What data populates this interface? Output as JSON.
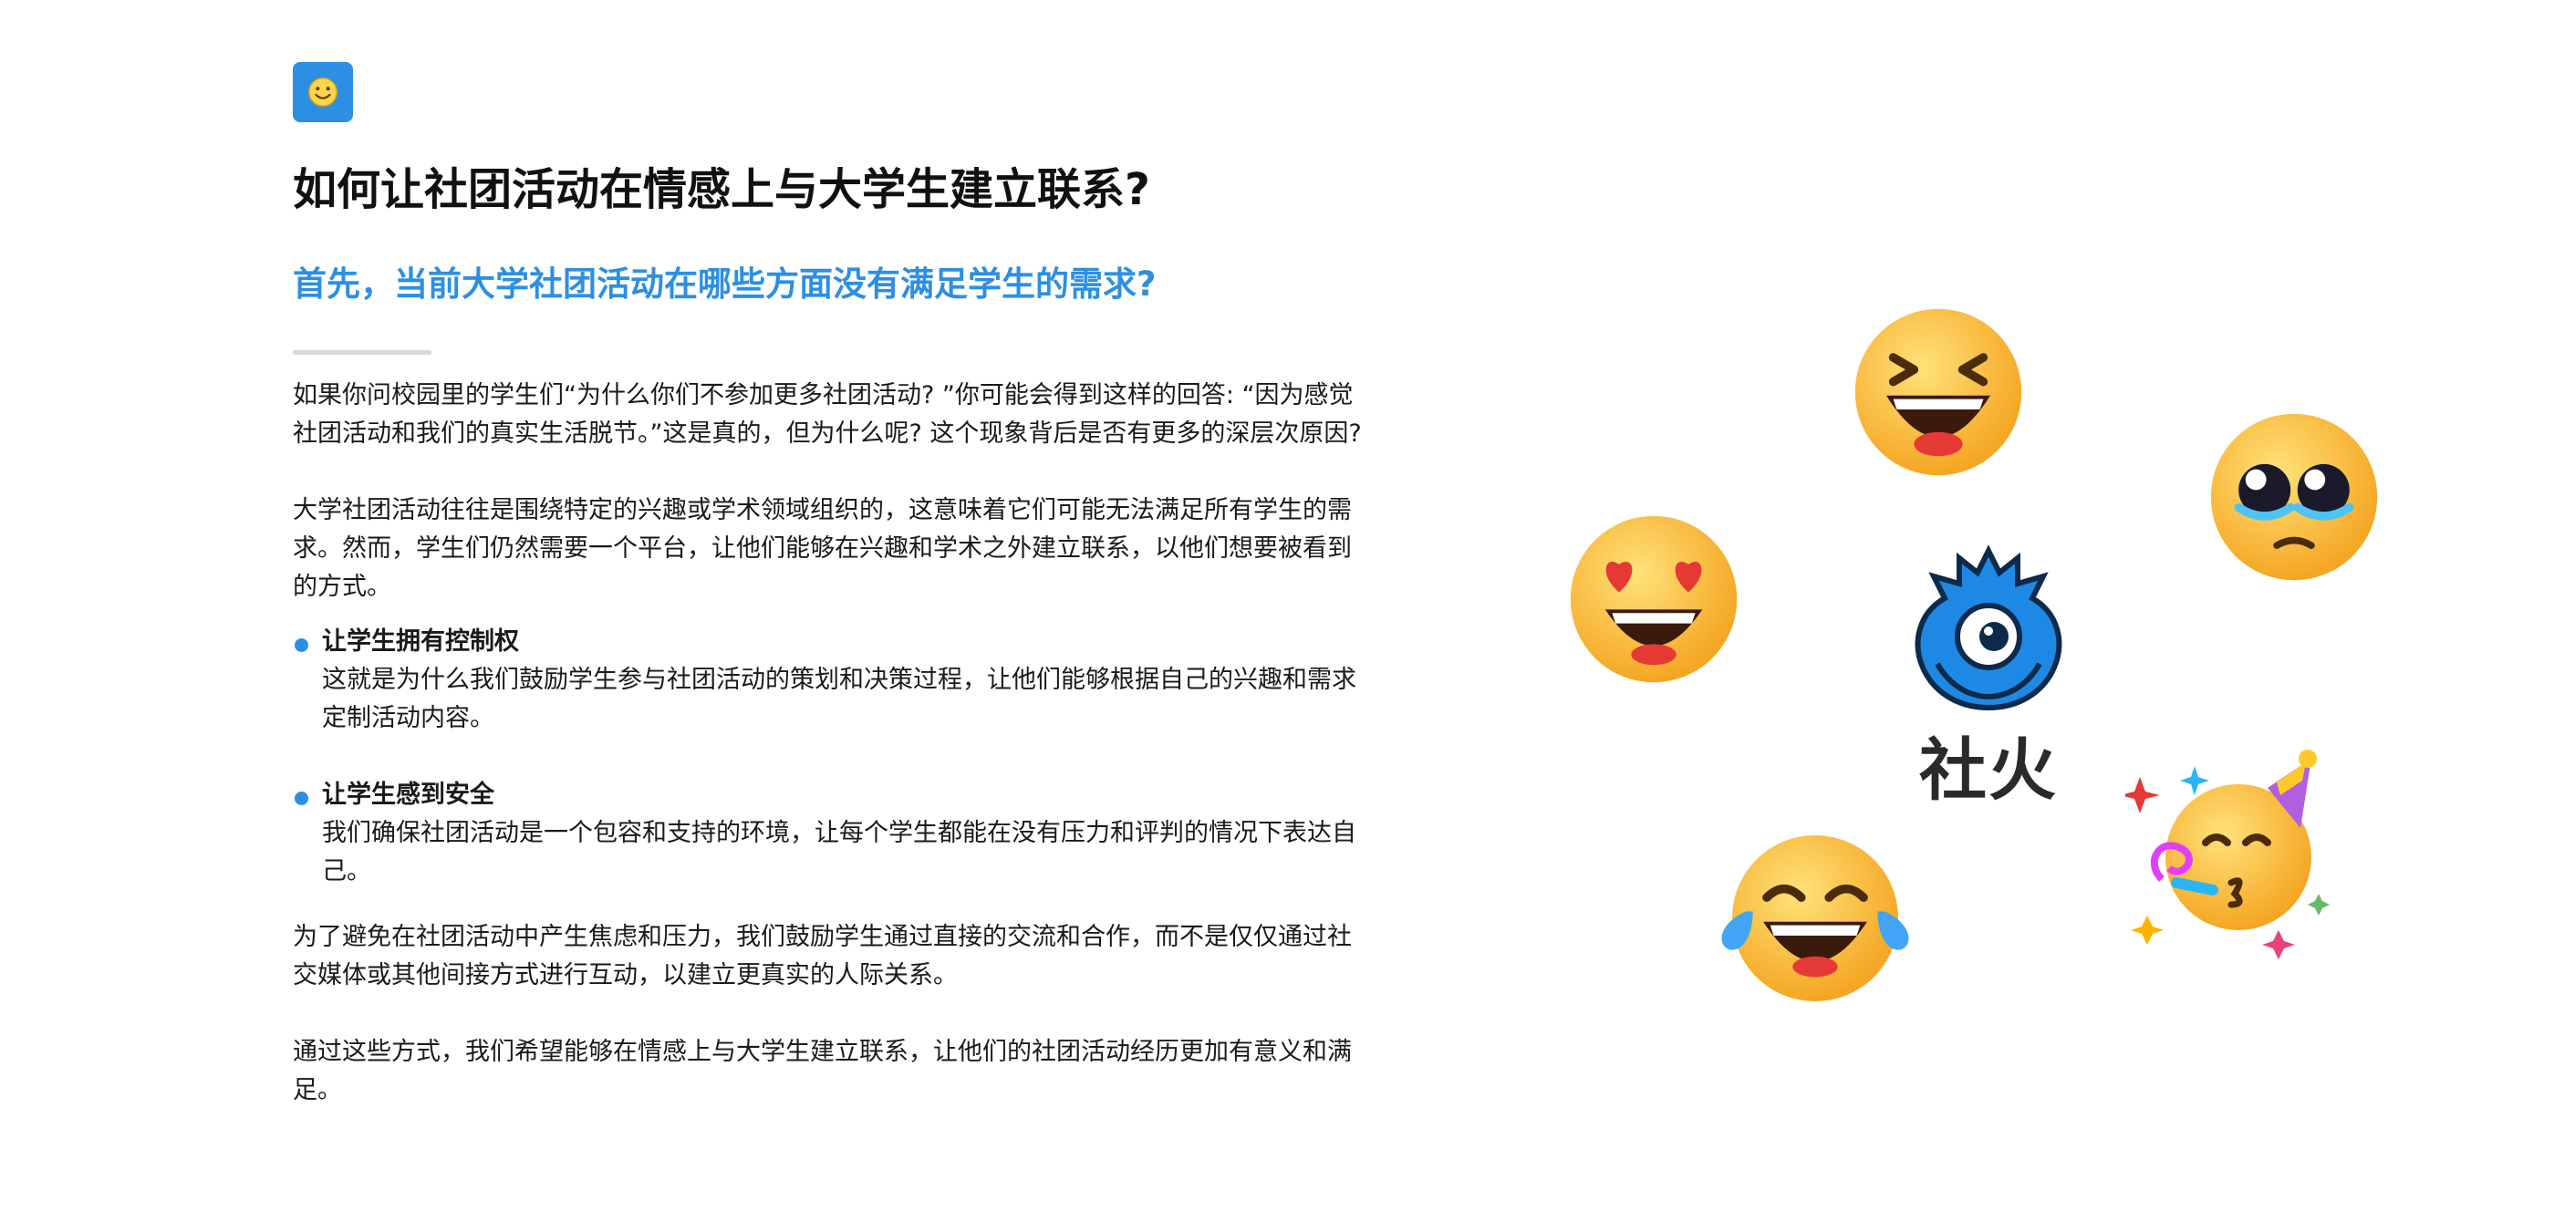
{
  "header": {
    "icon": "smiley-app-icon",
    "title": "如何让社团活动在情感上与大学生建立联系?",
    "subtitle": "首先，当前大学社团活动在哪些方面没有满足学生的需求?"
  },
  "content": {
    "p1": "如果你问校园里的学生们“为什么你们不参加更多社团活动? ”你可能会得到这样的回答: “因为感觉社团活动和我们的真实生活脱节。”这是真的，但为什么呢? 这个现象背后是否有更多的深层次原因?",
    "p2": "大学社团活动往往是围绕特定的兴趣或学术领域组织的，这意味着它们可能无法满足所有学生的需求。然而，学生们仍然需要一个平台，让他们能够在兴趣和学术之外建立联系，以他们想要被看到的方式。",
    "bullets": [
      {
        "title": "让学生拥有控制权",
        "body": "这就是为什么我们鼓励学生参与社团活动的策划和决策过程，让他们能够根据自己的兴趣和需求定制活动内容。"
      },
      {
        "title": "让学生感到安全",
        "body": "我们确保社团活动是一个包容和支持的环境，让每个学生都能在没有压力和评判的情况下表达自己。"
      }
    ],
    "p3": "为了避免在社团活动中产生焦虑和压力，我们鼓励学生通过直接的交流和合作，而不是仅仅通过社交媒体或其他间接方式进行互动，以建立更真实的人际关系。",
    "p4": "通过这些方式，我们希望能够在情感上与大学生建立联系，让他们的社团活动经历更加有意义和满足。"
  },
  "illustration": {
    "brand_name": "社火",
    "mascot": "blue-flame-mascot-icon",
    "emojis": [
      "grinning-squinting-face",
      "pleading-face",
      "heart-eyes-face",
      "partying-face",
      "tears-of-joy-face"
    ]
  },
  "colors": {
    "accent": "#2d8fe3",
    "text": "#1a1a1a",
    "divider": "#d9d9d9",
    "emoji_yellow": "#fbc02d"
  }
}
